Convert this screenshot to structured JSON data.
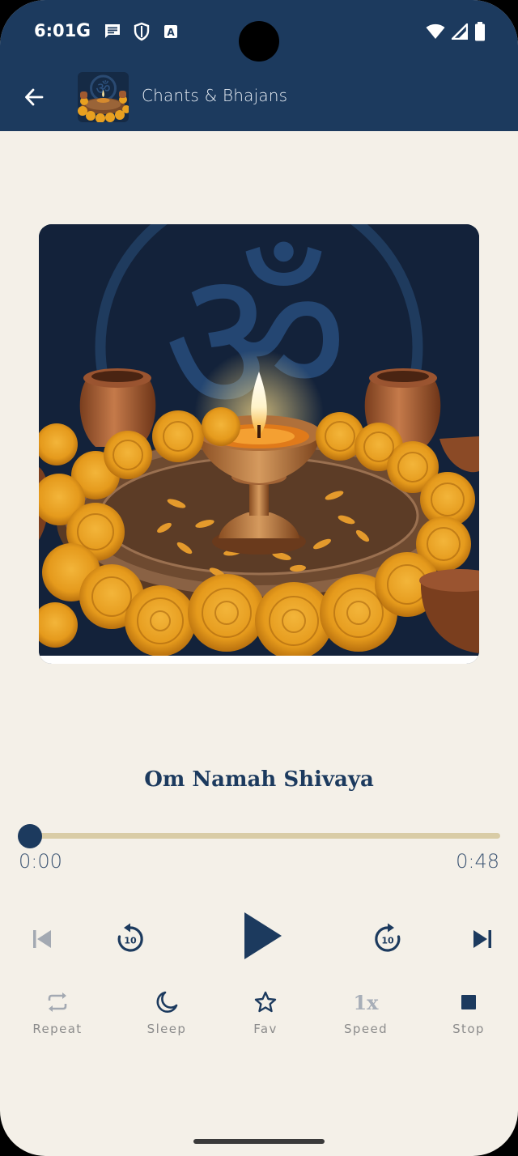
{
  "status_bar": {
    "time": "6:01",
    "google_letter": "G",
    "icons_left": [
      "google-icon",
      "message-icon",
      "shield-icon",
      "font-a-icon"
    ],
    "icons_right": [
      "wifi-icon",
      "signal-icon",
      "battery-icon"
    ],
    "font_badge": "A"
  },
  "app_bar": {
    "back_icon": "back-arrow-icon",
    "title": "Chants & Bhajans"
  },
  "player": {
    "track_title": "Om Namah Shivaya",
    "current_time": "0:00",
    "total_time": "0:48",
    "progress": 0.0
  },
  "transport": {
    "previous": "skip-previous-icon",
    "rewind": {
      "icon": "replay-10-icon",
      "label": "10"
    },
    "play": "play-icon",
    "forward": {
      "icon": "forward-10-icon",
      "label": "10"
    },
    "next": "skip-next-icon"
  },
  "actions": [
    {
      "id": "repeat",
      "label": "Repeat",
      "icon": "repeat-icon"
    },
    {
      "id": "sleep",
      "label": "Sleep",
      "icon": "moon-icon"
    },
    {
      "id": "fav",
      "label": "Fav",
      "icon": "star-icon"
    },
    {
      "id": "speed",
      "label": "Speed",
      "icon": "speed-icon",
      "value": "1x"
    },
    {
      "id": "stop",
      "label": "Stop",
      "icon": "stop-icon"
    }
  ],
  "colors": {
    "header": "#1C3A5E",
    "background": "#F4F0E8",
    "accent": "#1C3A5E",
    "seek_track": "#D9CCA6",
    "muted_label": "#8C8C8C"
  }
}
